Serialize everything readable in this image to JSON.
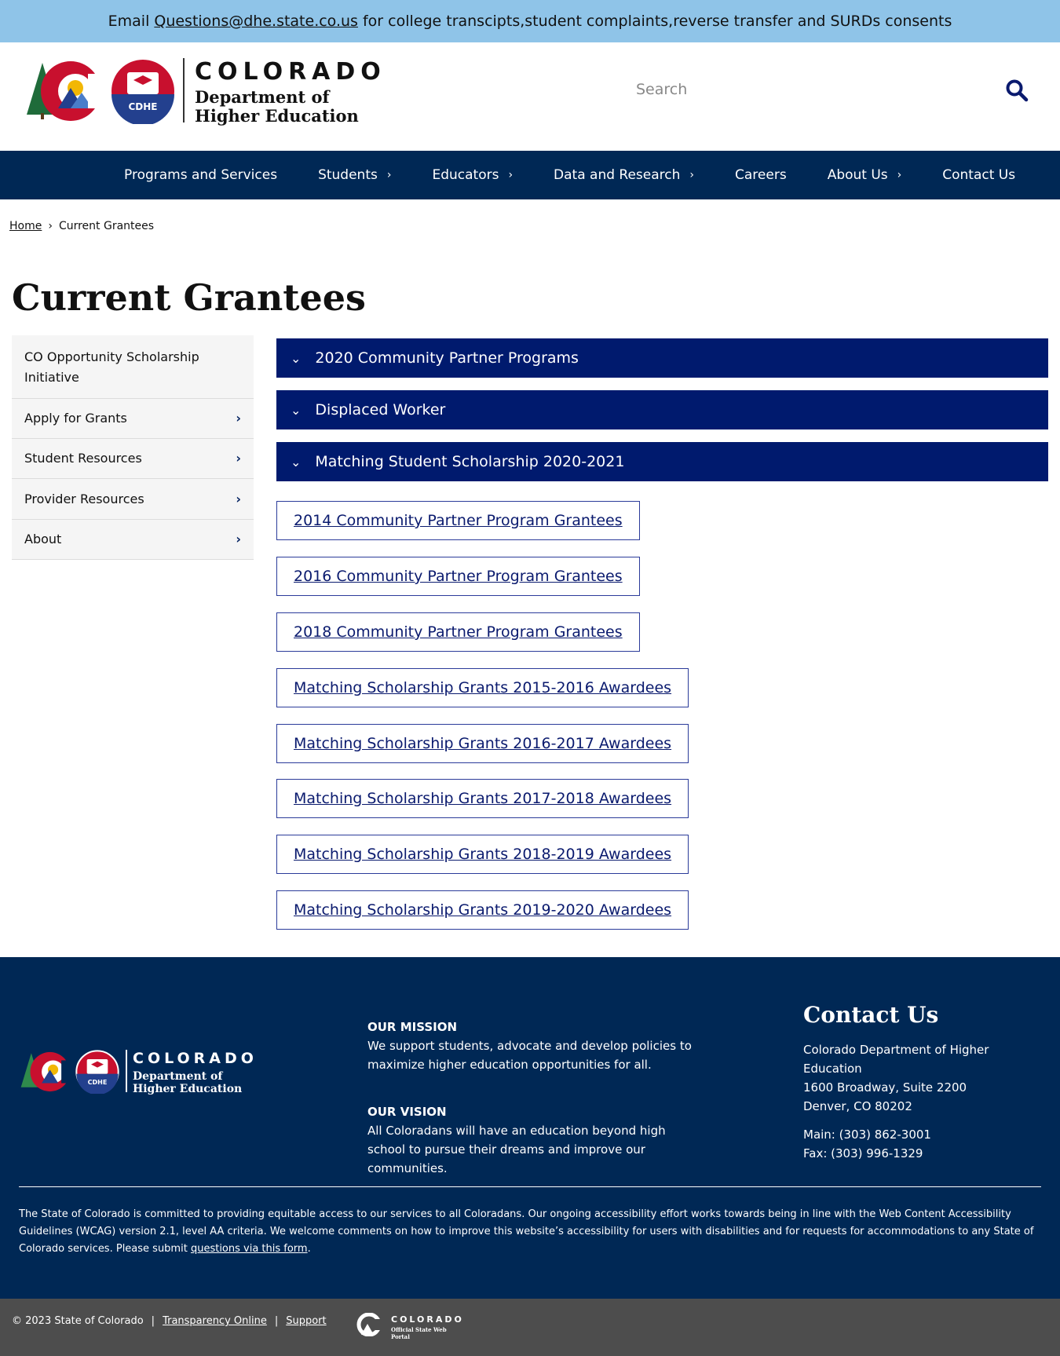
{
  "topbar": {
    "prefix": "Email",
    "email": "Questions@dhe.state.co.us",
    "suffix": "for college transcipts,student complaints,reverse transfer and SURDs consents"
  },
  "header": {
    "logo_state": "COLORADO",
    "logo_dept": "Department of Higher Education",
    "logo_badge": "CDHE",
    "search_placeholder": "Search"
  },
  "nav": {
    "items": [
      {
        "label": "Programs and Services",
        "chevron": false
      },
      {
        "label": "Students",
        "chevron": true
      },
      {
        "label": "Educators",
        "chevron": true
      },
      {
        "label": "Data and Research",
        "chevron": true
      },
      {
        "label": "Careers",
        "chevron": false
      },
      {
        "label": "About Us",
        "chevron": true
      },
      {
        "label": "Contact Us",
        "chevron": false
      }
    ]
  },
  "breadcrumb": {
    "home": "Home",
    "current": "Current Grantees"
  },
  "page_title": "Current Grantees",
  "sidebar": {
    "items": [
      {
        "label": "CO Opportunity Scholarship Initiative"
      },
      {
        "label": "Apply for Grants"
      },
      {
        "label": "Student Resources"
      },
      {
        "label": "Provider Resources"
      },
      {
        "label": "About"
      }
    ]
  },
  "accordions": [
    {
      "label": "2020 Community Partner Programs"
    },
    {
      "label": "Displaced Worker"
    },
    {
      "label": "Matching Student Scholarship 2020-2021"
    }
  ],
  "links": [
    {
      "label": "2014 Community Partner Program Grantees"
    },
    {
      "label": "2016 Community Partner Program Grantees"
    },
    {
      "label": "2018 Community Partner Program Grantees"
    },
    {
      "label": "Matching Scholarship Grants 2015-2016 Awardees"
    },
    {
      "label": "Matching Scholarship Grants 2016-2017 Awardees"
    },
    {
      "label": "Matching Scholarship Grants 2017-2018 Awardees"
    },
    {
      "label": "Matching Scholarship Grants 2018-2019 Awardees"
    },
    {
      "label": "Matching Scholarship Grants 2019-2020 Awardees"
    }
  ],
  "footer": {
    "mission_title": "OUR MISSION",
    "mission_text": "We support students, advocate and develop policies to maximize higher education opportunities for all.",
    "vision_title": "OUR VISION",
    "vision_text": "All Coloradans will have an education beyond high school to pursue their dreams and improve our communities.",
    "contact_title": "Contact Us",
    "org": "Colorado Department of Higher Education",
    "address1": "1600 Broadway, Suite 2200",
    "address2": "Denver, CO 80202",
    "phone": "Main: (303) 862-3001",
    "fax": "Fax: (303) 996-1329",
    "accessibility_text": "The State of Colorado is committed to providing equitable access to our services to all Coloradans. Our ongoing accessibility effort works towards being in line with the Web Content Accessibility Guidelines (WCAG) version 2.1, level AA criteria. We welcome comments on how to improve this website’s accessibility for users with disabilities and for requests for accommodations to any State of Colorado services. Please submit",
    "accessibility_link": "questions via this form",
    "accessibility_end": "."
  },
  "bottombar": {
    "copyright": "© 2023 State of Colorado",
    "transparency": "Transparency Online",
    "support": "Support",
    "portal_state": "COLORADO",
    "portal_sub": "Official State Web Portal"
  },
  "colors": {
    "topbar": "#8fc4e8",
    "nav": "#002855",
    "accordion": "#001a6e",
    "footer": "#002855",
    "bottombar": "#4d4d4d"
  }
}
